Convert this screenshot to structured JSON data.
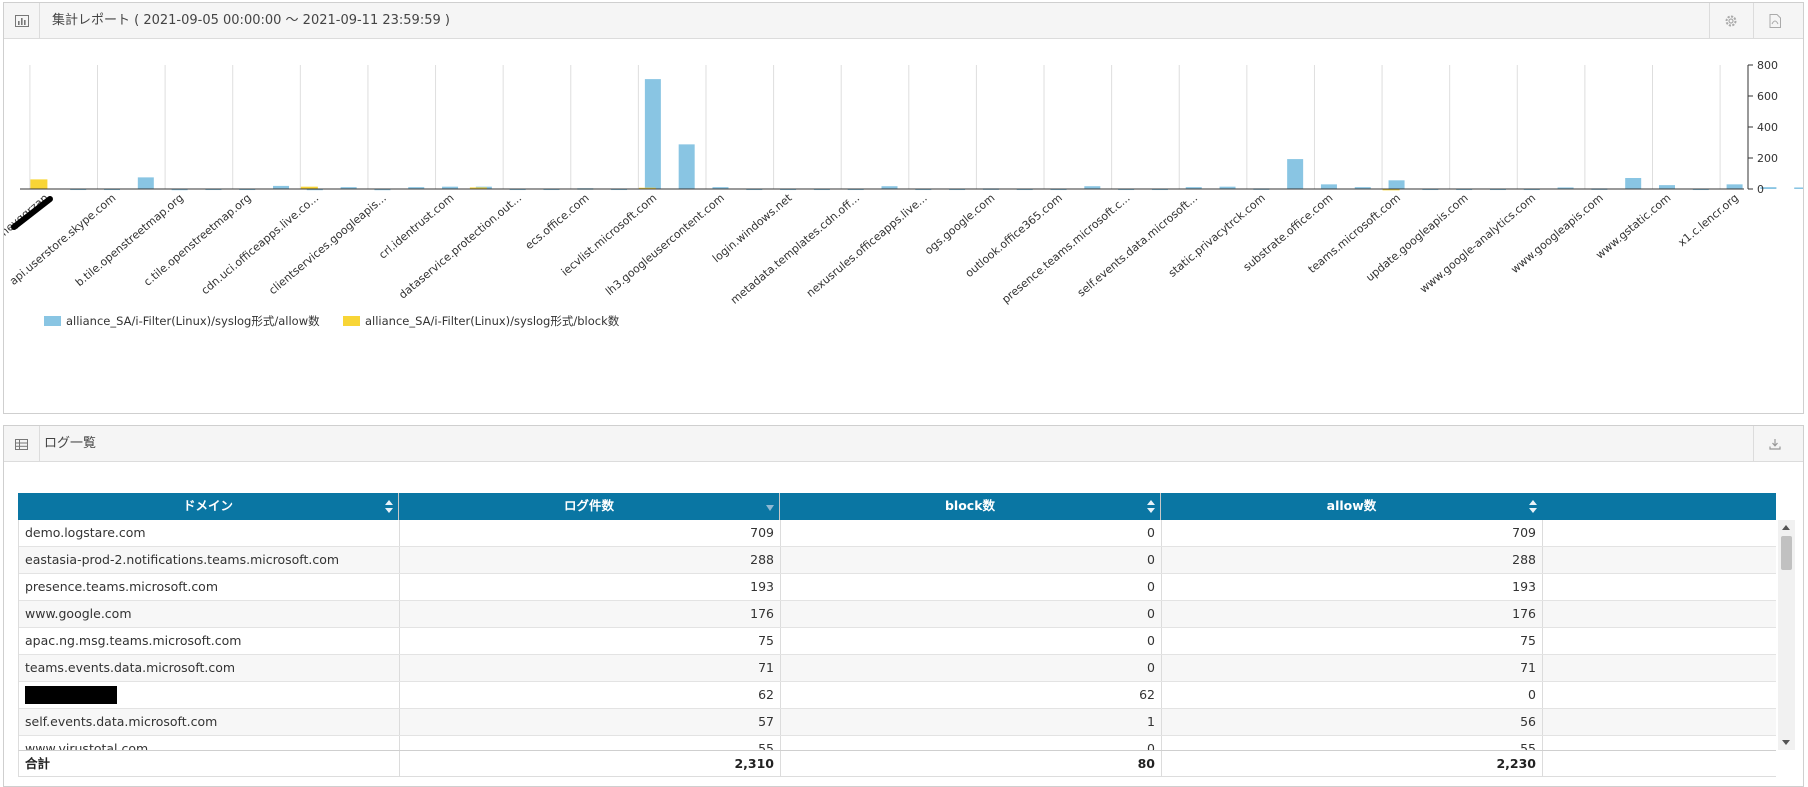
{
  "chart_panel": {
    "title": "集計レポート ( 2021-09-05 00:00:00 ～ 2021-09-11 23:59:59 )",
    "icon": "bar-chart-icon",
    "actions": [
      "gear-icon",
      "pdf-icon"
    ]
  },
  "log_panel": {
    "title": "ログ一覧",
    "icon": "table-icon",
    "actions": [
      "download-icon"
    ]
  },
  "chart_data": {
    "type": "bar",
    "title": "",
    "xlabel": "",
    "ylabel": "",
    "ylim": [
      0,
      800
    ],
    "yticks": [
      0,
      200,
      400,
      600,
      800
    ],
    "grid": true,
    "legend_position": "bottom-left",
    "categories": [
      "alraomeyqgrzap",
      "",
      "api.userstore.skype.com",
      "",
      "b.tile.openstreetmap.org",
      "",
      "c.tile.openstreetmap.org",
      "",
      "cdn.uci.officeapps.live.co...",
      "",
      "clientservices.googleapis...",
      "",
      "crl.identrust.com",
      "",
      "dataservice.protection.out...",
      "",
      "ecs.office.com",
      "",
      "iecvlist.microsoft.com",
      "",
      "lh3.googleusercontent.com",
      "",
      "login.windows.net",
      "",
      "metadata.templates.cdn.off...",
      "",
      "nexusrules.officeapps.live...",
      "",
      "ogs.google.com",
      "",
      "outlook.office365.com",
      "",
      "presence.teams.microsoft.c...",
      "",
      "self.events.data.microsoft...",
      "",
      "static.privacytrck.com",
      "",
      "substrate.office.com",
      "",
      "teams.microsoft.com",
      "",
      "update.googleapis.com",
      "",
      "www.google-analytics.com",
      "",
      "www.googleapis.com",
      "",
      "www.gstatic.com",
      "",
      "x1.c.lencr.org"
    ],
    "series": [
      {
        "name": "alliance_SA/i-Filter(Linux)/syslog形式/allow数",
        "color": "#89c5e3",
        "values": [
          0,
          3,
          3,
          75,
          2,
          3,
          3,
          20,
          2,
          12,
          2,
          12,
          15,
          15,
          3,
          3,
          5,
          3,
          709,
          288,
          12,
          3,
          3,
          3,
          3,
          18,
          3,
          3,
          4,
          3,
          3,
          18,
          3,
          3,
          12,
          15,
          4,
          193,
          30,
          12,
          56,
          3,
          3,
          3,
          3,
          10,
          4,
          71,
          25,
          3,
          30,
          12,
          10,
          8,
          40,
          3,
          176,
          3,
          3,
          10,
          4,
          3,
          55
        ]
      },
      {
        "name": "alliance_SA/i-Filter(Linux)/syslog形式/block数",
        "color": "#f8d536",
        "values": [
          62,
          0,
          0,
          0,
          0,
          0,
          0,
          0,
          15,
          0,
          0,
          0,
          0,
          10,
          0,
          0,
          0,
          0,
          8,
          0,
          0,
          0,
          0,
          0,
          0,
          0,
          0,
          0,
          0,
          0,
          0,
          0,
          0,
          0,
          0,
          0,
          0,
          0,
          0,
          0,
          1,
          0,
          0,
          0,
          0,
          0,
          0,
          0,
          0,
          0,
          0,
          0,
          0,
          0,
          0,
          0,
          0,
          0,
          0,
          0,
          0,
          0,
          0
        ]
      }
    ]
  },
  "table": {
    "columns": [
      {
        "label": "ドメイン",
        "sort": "both"
      },
      {
        "label": "ログ件数",
        "sort": "desc"
      },
      {
        "label": "block数",
        "sort": "both"
      },
      {
        "label": "allow数",
        "sort": "both"
      }
    ],
    "rows": [
      {
        "domain": "demo.logstare.com",
        "count": "709",
        "block": "0",
        "allow": "709"
      },
      {
        "domain": "eastasia-prod-2.notifications.teams.microsoft.com",
        "count": "288",
        "block": "0",
        "allow": "288"
      },
      {
        "domain": "presence.teams.microsoft.com",
        "count": "193",
        "block": "0",
        "allow": "193"
      },
      {
        "domain": "www.google.com",
        "count": "176",
        "block": "0",
        "allow": "176"
      },
      {
        "domain": "apac.ng.msg.teams.microsoft.com",
        "count": "75",
        "block": "0",
        "allow": "75"
      },
      {
        "domain": "teams.events.data.microsoft.com",
        "count": "71",
        "block": "0",
        "allow": "71"
      },
      {
        "domain": "",
        "redacted": true,
        "count": "62",
        "block": "62",
        "allow": "0"
      },
      {
        "domain": "self.events.data.microsoft.com",
        "count": "57",
        "block": "1",
        "allow": "56"
      },
      {
        "domain": "www.virustotal.com",
        "count": "55",
        "block": "0",
        "allow": "55"
      }
    ],
    "footer": {
      "label": "合計",
      "count": "2,310",
      "block": "80",
      "allow": "2,230"
    }
  }
}
